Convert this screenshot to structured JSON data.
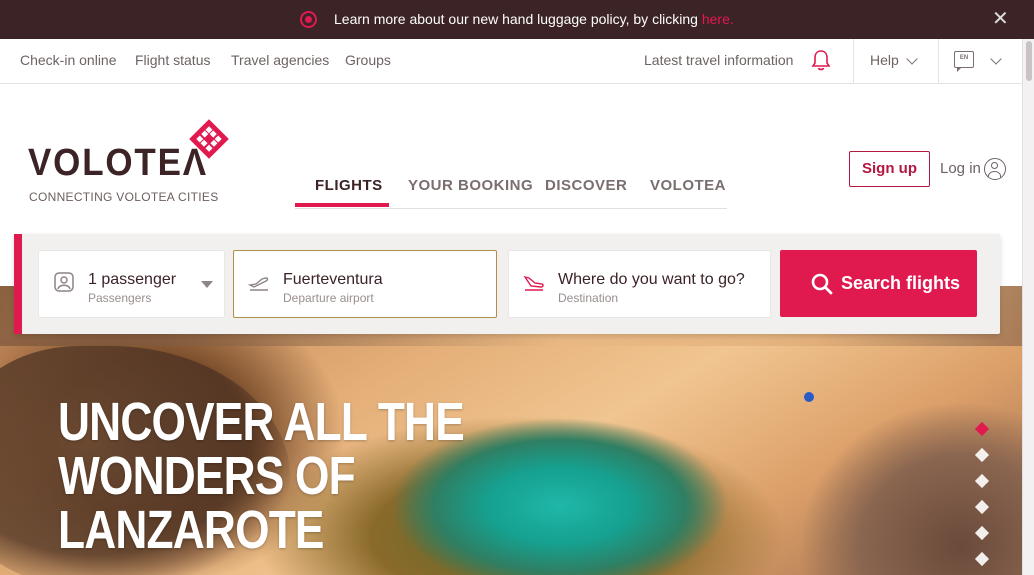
{
  "announcement": {
    "text": "Learn more about our new hand luggage policy, by clicking ",
    "link": "here.",
    "close": "✕"
  },
  "utility": {
    "links": [
      "Check-in online",
      "Flight status",
      "Travel agencies",
      "Groups"
    ],
    "latest": "Latest travel information",
    "help": "Help",
    "lang": "EN"
  },
  "brand": {
    "name": "VOLOTEΛ",
    "tagline": "CONNECTING VOLOTEA CITIES"
  },
  "nav": {
    "tabs": [
      "FLIGHTS",
      "YOUR BOOKING",
      "DISCOVER",
      "VOLOTEA"
    ],
    "active": 0
  },
  "account": {
    "signup": "Sign up",
    "login": "Log in"
  },
  "search": {
    "passengers": {
      "value": "1 passenger",
      "label": "Passengers"
    },
    "departure": {
      "value": "Fuerteventura",
      "label": "Departure airport"
    },
    "destination": {
      "value": "Where do you want to go?",
      "label": "Destination"
    },
    "button": "Search flights"
  },
  "hero": {
    "lines": [
      "UNCOVER ALL THE",
      "WONDERS OF",
      "LANZAROTE"
    ],
    "slides": 6,
    "active_slide": 0
  },
  "colors": {
    "brand_red": "#e0194e",
    "dark_brown": "#3b2326"
  }
}
